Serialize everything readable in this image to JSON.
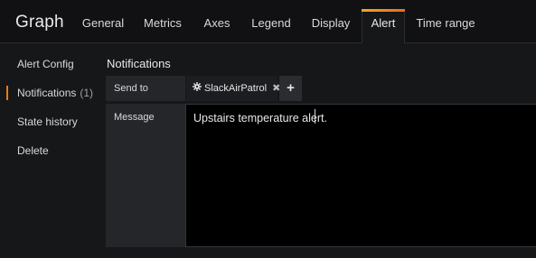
{
  "editor": {
    "title": "Graph"
  },
  "tabs": [
    {
      "label": "General"
    },
    {
      "label": "Metrics"
    },
    {
      "label": "Axes"
    },
    {
      "label": "Legend"
    },
    {
      "label": "Display"
    },
    {
      "label": "Alert",
      "active": true
    },
    {
      "label": "Time range"
    }
  ],
  "sidebar": {
    "items": [
      {
        "label": "Alert Config"
      },
      {
        "label": "Notifications",
        "count": "(1)",
        "active": true
      },
      {
        "label": "State history"
      },
      {
        "label": "Delete"
      }
    ]
  },
  "notifications": {
    "title": "Notifications",
    "send_to_label": "Send to",
    "channel_tag": "SlackAirPatrol",
    "remove_symbol": "✖",
    "add_symbol": "+",
    "message_label": "Message",
    "message_value": "Upstairs temperature alert."
  },
  "colors": {
    "accent": "#eb7b18",
    "background": "#161719",
    "header": "#111113",
    "label_bg": "#25262a",
    "message_bg": "#000000"
  },
  "icons": {
    "channel": "gear-icon",
    "remove": "close-icon",
    "add": "plus-icon"
  }
}
